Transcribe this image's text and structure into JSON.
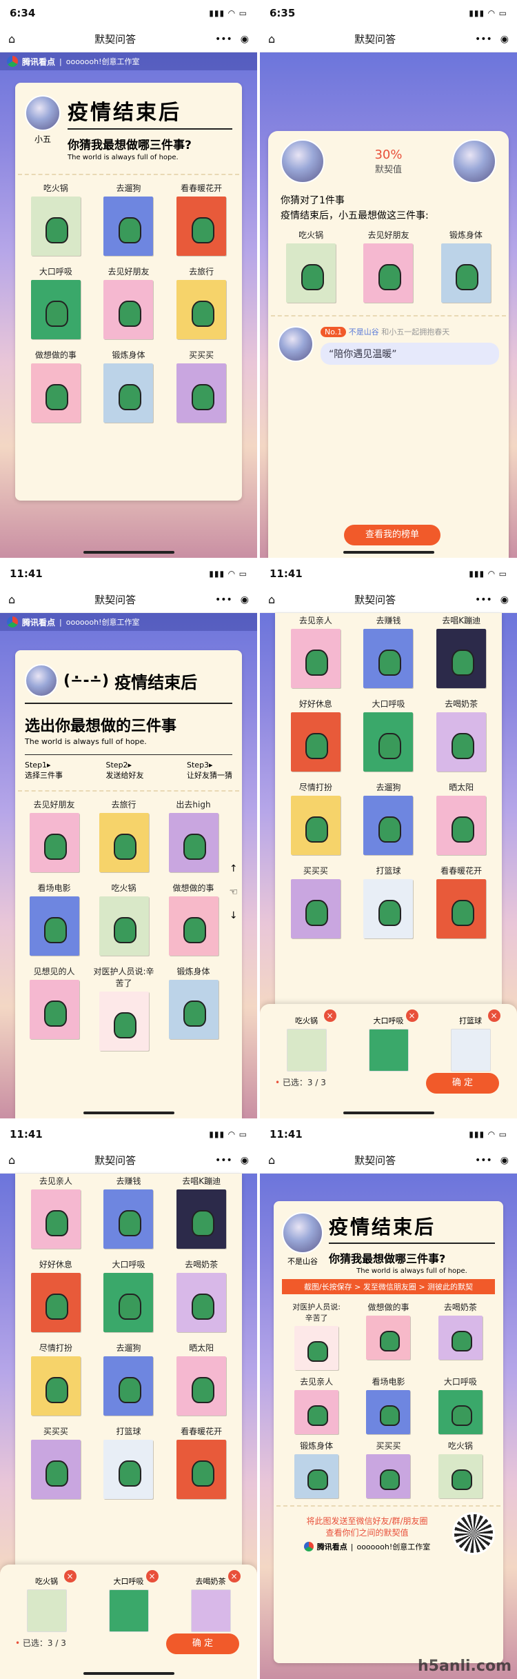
{
  "screens": [
    {
      "time": "6:34",
      "nav_title": "默契问答"
    },
    {
      "time": "6:35",
      "nav_title": "默契问答"
    },
    {
      "time": "11:41",
      "nav_title": "默契问答"
    },
    {
      "time": "11:41",
      "nav_title": "默契问答"
    },
    {
      "time": "11:41",
      "nav_title": "默契问答"
    },
    {
      "time": "11:41",
      "nav_title": "默契问答"
    }
  ],
  "brand": {
    "name": "腾讯看点",
    "studio": "ooooooh!创意工作室"
  },
  "s1": {
    "user": "小五",
    "title": "疫情结束后",
    "question": "你猜我最想做哪三件事?",
    "subtitle": "The world is always full of hope.",
    "items": [
      "吃火锅",
      "去遛狗",
      "看春暖花开",
      "大口呼吸",
      "去见好朋友",
      "去旅行",
      "做想做的事",
      "锻炼身体",
      "买买买"
    ]
  },
  "s2": {
    "percent": "30%",
    "label": "默契值",
    "guess": "你猜对了1件事",
    "answer": "疫情结束后，小五最想做这三件事:",
    "items": [
      "吃火锅",
      "去见好朋友",
      "锻炼身体"
    ],
    "rank_no": "No.1",
    "rank_name": "不是山谷",
    "rank_desc": "和小五一起拥抱春天",
    "quote": "“陪你遇见温暖”",
    "button": "查看我的榜单"
  },
  "s3": {
    "emoji": "(∸-∸)",
    "title": "疫情结束后",
    "heading": "选出你最想做的三件事",
    "subtitle": "The world is always full of hope.",
    "steps": [
      {
        "k": "Step1▸",
        "v": "选择三件事"
      },
      {
        "k": "Step2▸",
        "v": "发送给好友"
      },
      {
        "k": "Step3▸",
        "v": "让好友猜一猜"
      }
    ],
    "items": [
      "去见好朋友",
      "去旅行",
      "出去high",
      "看场电影",
      "吃火锅",
      "做想做的事",
      "见想见的人",
      "对医护人员说:辛苦了",
      "锻炼身体"
    ]
  },
  "s4": {
    "items": [
      "去见亲人",
      "去赚钱",
      "去唱K蹦迪",
      "好好休息",
      "大口呼吸",
      "去喝奶茶",
      "尽情打扮",
      "去遛狗",
      "晒太阳",
      "买买买",
      "打篮球",
      "看春暖花开"
    ],
    "selected": [
      "吃火锅",
      "大口呼吸",
      "打篮球"
    ],
    "count": "已选：3 / 3",
    "ok": "确 定"
  },
  "s5": {
    "items": [
      "去见亲人",
      "去赚钱",
      "去唱K蹦迪",
      "好好休息",
      "大口呼吸",
      "去喝奶茶",
      "尽情打扮",
      "去遛狗",
      "晒太阳",
      "买买买",
      "打篮球",
      "看春暖花开"
    ],
    "selected": [
      "吃火锅",
      "大口呼吸",
      "去喝奶茶"
    ],
    "count": "已选：3 / 3",
    "ok": "确 定"
  },
  "s6": {
    "user": "不是山谷",
    "title": "疫情结束后",
    "question": "你猜我最想做哪三件事?",
    "subtitle": "The world is always full of hope.",
    "banner": "截图/长按保存 > 发至微信朋友圈 > 测彼此的默契",
    "items": [
      "对医护人员说:辛苦了",
      "做想做的事",
      "去喝奶茶",
      "去见亲人",
      "看场电影",
      "大口呼吸",
      "锻炼身体",
      "买买买",
      "吃火锅"
    ],
    "share1": "将此图发送至微信好友/群/朋友圈",
    "share2": "查看你们之间的默契值"
  },
  "watermark": "h5anli.com",
  "colors": {
    "accent": "#f15a2a",
    "cream": "#fdf6e4"
  }
}
